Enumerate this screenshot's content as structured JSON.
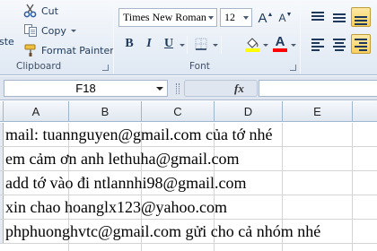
{
  "ribbon": {
    "clipboard": {
      "paste_label": "ste",
      "cut_label": "Cut",
      "copy_label": "Copy",
      "format_painter_label": "Format Painter",
      "group_label": "Clipboard",
      "icons": [
        "scissors-icon",
        "copy-icon",
        "paintbrush-icon"
      ]
    },
    "font": {
      "font_name": "Times New Roman",
      "font_size": "12",
      "grow_label": "A",
      "shrink_label": "A",
      "bold_label": "B",
      "italic_label": "I",
      "underline_label": "U",
      "font_color_label": "A",
      "group_label": "Font",
      "fill_color": "#ffff00",
      "font_color": "#ff0000"
    },
    "alignment": {
      "icons": [
        "align-top-icon",
        "align-middle-icon",
        "align-bottom-icon",
        "align-left-icon",
        "align-center-icon",
        "align-right-icon"
      ]
    }
  },
  "formula_bar": {
    "name_box": "F18",
    "fx_label": "fx",
    "formula": ""
  },
  "grid": {
    "columns": [
      "A",
      "B",
      "C",
      "D",
      "E"
    ],
    "rows": [
      "mail: tuannguyen@gmail.com của tớ nhé",
      "em cảm ơn anh lethuha@gmail.com",
      "add tớ vào đi ntlannhi98@gmail.com",
      "xin chao hoanglx123@yahoo.com",
      "phphuonghvtc@gmail.com gửi cho cả nhóm nhé"
    ]
  },
  "colors": {
    "ribbon_bg": "#dfe8f3",
    "header_bg": "#e0e7f0",
    "grid_line": "#d4d4d4",
    "active_align": "#f8cf5b"
  }
}
